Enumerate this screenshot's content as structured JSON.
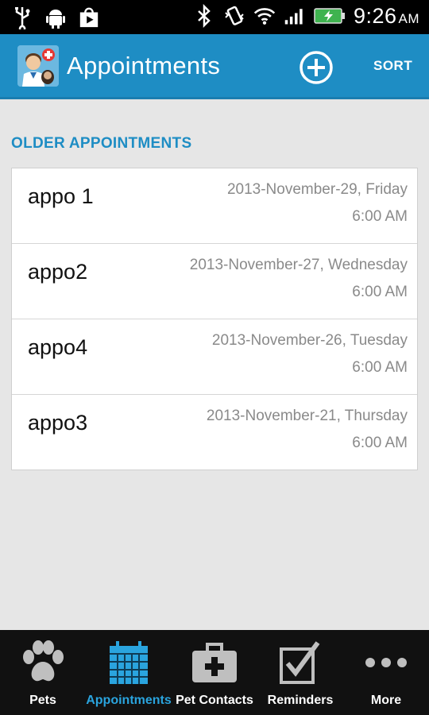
{
  "status_bar": {
    "time": "9:26",
    "ampm": "AM",
    "icons": [
      "usb-icon",
      "android-debug-icon",
      "play-store-icon",
      "bluetooth-icon",
      "vibrate-icon",
      "wifi-icon",
      "signal-icon",
      "battery-charging-icon"
    ]
  },
  "action_bar": {
    "title": "Appointments",
    "sort_label": "SORT",
    "add_icon": "add-circle-icon",
    "logo_icon": "vet-logo-icon"
  },
  "section": {
    "header": "OLDER APPOINTMENTS"
  },
  "appointments": [
    {
      "name": "appo 1",
      "date": "2013-November-29, Friday",
      "time": "6:00 AM"
    },
    {
      "name": "appo2",
      "date": "2013-November-27, Wednesday",
      "time": "6:00 AM"
    },
    {
      "name": "appo4",
      "date": "2013-November-26, Tuesday",
      "time": "6:00 AM"
    },
    {
      "name": "appo3",
      "date": "2013-November-21, Thursday",
      "time": "6:00 AM"
    }
  ],
  "bottom_nav": [
    {
      "label": "Pets",
      "icon": "paw-icon",
      "active": false
    },
    {
      "label": "Appointments",
      "icon": "calendar-icon",
      "active": true
    },
    {
      "label": "Pet Contacts",
      "icon": "first-aid-kit-icon",
      "active": false
    },
    {
      "label": "Reminders",
      "icon": "checkbox-icon",
      "active": false
    },
    {
      "label": "More",
      "icon": "more-dots-icon",
      "active": false
    }
  ],
  "colors": {
    "accent": "#1e8dc4",
    "active_nav": "#2aa4de",
    "nav_background": "#111111",
    "content_background": "#e6e6e6"
  }
}
